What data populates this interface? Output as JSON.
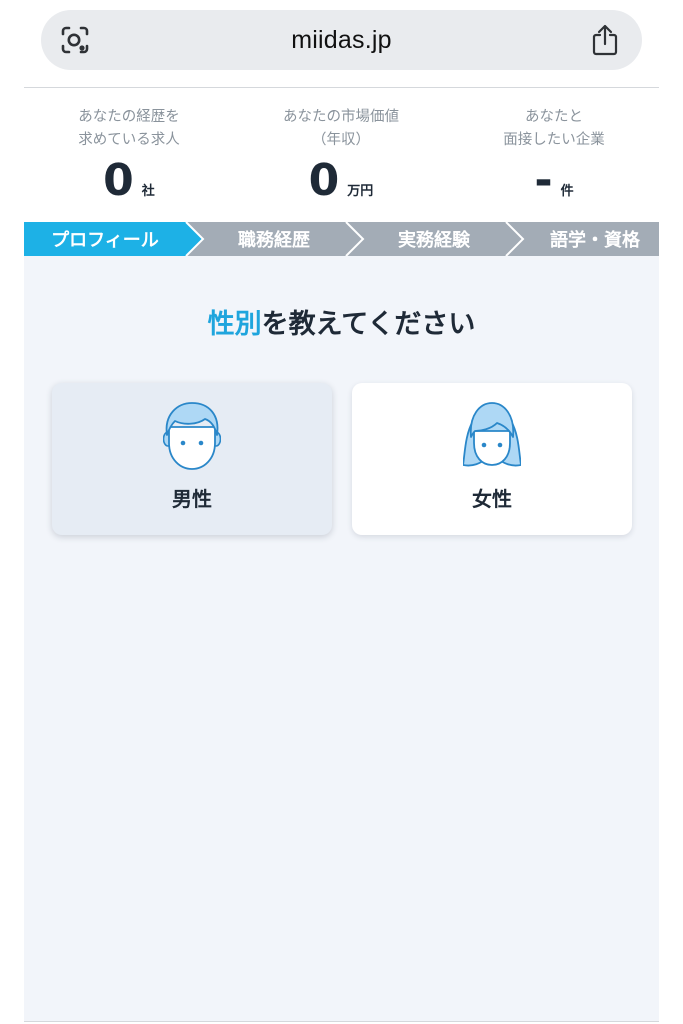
{
  "browser": {
    "url": "miidas.jp",
    "lens_icon": "camera-lens-icon",
    "share_icon": "share-icon"
  },
  "stats": [
    {
      "caption": "あなたの経歴を\n求めている求人",
      "value": "0",
      "unit": "社"
    },
    {
      "caption": "あなたの市場価値\n（年収）",
      "value": "0",
      "unit": "万円"
    },
    {
      "caption": "あなたと\n面接したい企業",
      "value": "-",
      "unit": "件"
    }
  ],
  "steps": [
    {
      "label": "プロフィール",
      "active": true
    },
    {
      "label": "職務経歴",
      "active": false
    },
    {
      "label": "実務経験",
      "active": false
    },
    {
      "label": "語学・資格",
      "active": false
    }
  ],
  "question": {
    "highlight": "性別",
    "rest": "を教えてください"
  },
  "options": {
    "male": {
      "label": "男性",
      "icon": "male-face-icon",
      "selected": true
    },
    "female": {
      "label": "女性",
      "icon": "female-face-icon",
      "selected": false
    }
  },
  "colors": {
    "accent": "#1db1e6",
    "step_inactive": "#a3acb6",
    "icon_fill": "#aed8f5",
    "icon_stroke": "#2a87c9"
  }
}
